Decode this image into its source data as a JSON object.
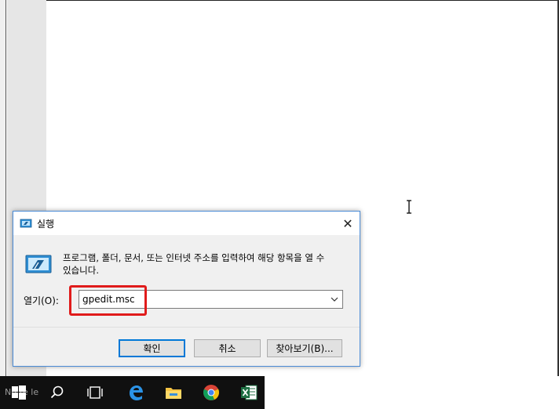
{
  "dialog": {
    "title": "실행",
    "close_glyph": "✕",
    "description": "프로그램, 폴더, 문서, 또는 인터넷 주소를 입력하여 해당 항목을 열 수 있습니다.",
    "open_label": "열기(O):",
    "input_value": "gpedit.msc",
    "ok_label": "확인",
    "cancel_label": "취소",
    "browse_label": "찾아보기(B)..."
  },
  "taskbar": {
    "search_placeholder": "Nh  te  le",
    "items": [
      "windows-start-icon",
      "search-icon",
      "task-view-icon",
      "edge-icon",
      "file-explorer-icon",
      "chrome-icon",
      "excel-icon"
    ]
  },
  "colors": {
    "accent": "#0078d7",
    "highlight": "#e01b1b",
    "taskbar": "#101010",
    "dialog_bg": "#f0f0f0"
  }
}
